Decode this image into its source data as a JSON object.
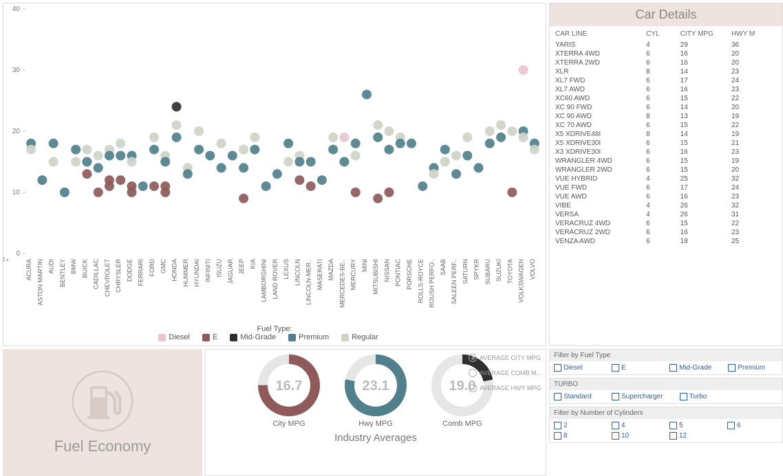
{
  "colors": {
    "diesel": "#e9c6cf",
    "e": "#8e5a5a",
    "mid": "#2f2f2f",
    "premium": "#4f808b",
    "regular": "#cdd5c7"
  },
  "chart_data": {
    "type": "scatter",
    "title": "",
    "xlabel": "",
    "ylabel": "",
    "ylim": [
      0,
      40
    ],
    "yticks": [
      0,
      10,
      20,
      30,
      40
    ],
    "x_categories": [
      "ACURA",
      "ASTON MARTIN",
      "AUDI",
      "BENTLEY",
      "BMW",
      "BUICK",
      "CADILLAC",
      "CHEVROLET",
      "CHRYSLER",
      "DODGE",
      "FERRARI",
      "FORD",
      "GMC",
      "HONDA",
      "HUMMER",
      "HYUNDAI",
      "INFINITI",
      "ISUZU",
      "JAGUAR",
      "JEEP",
      "KIA",
      "LAMBORGHINI",
      "LAND ROVER",
      "LEXUS",
      "LINCOLN",
      "LINCOLN-MER..",
      "MASERATI",
      "MAZDA",
      "MERCEDES-BE..",
      "MERCURY",
      "MINI",
      "MITSUBISHI",
      "NISSAN",
      "PONTIAC",
      "PORSCHE",
      "ROLLS-ROYCE",
      "ROUSH PERFO..",
      "SAAB",
      "SALEEN PERF..",
      "SATURN",
      "SPYKR",
      "SUBARU",
      "SUZUKI",
      "TOYOTA",
      "VOLKSWAGEN",
      "VOLVO"
    ],
    "points": [
      {
        "x": "ACURA",
        "y": 18,
        "fuel": "premium"
      },
      {
        "x": "ACURA",
        "y": 17,
        "fuel": "regular"
      },
      {
        "x": "ASTON MARTIN",
        "y": 12,
        "fuel": "premium"
      },
      {
        "x": "AUDI",
        "y": 18,
        "fuel": "premium"
      },
      {
        "x": "AUDI",
        "y": 15,
        "fuel": "regular"
      },
      {
        "x": "BENTLEY",
        "y": 10,
        "fuel": "premium"
      },
      {
        "x": "BMW",
        "y": 17,
        "fuel": "premium"
      },
      {
        "x": "BMW",
        "y": 15,
        "fuel": "regular"
      },
      {
        "x": "BUICK",
        "y": 15,
        "fuel": "premium"
      },
      {
        "x": "BUICK",
        "y": 17,
        "fuel": "regular"
      },
      {
        "x": "BUICK",
        "y": 13,
        "fuel": "e"
      },
      {
        "x": "CADILLAC",
        "y": 16,
        "fuel": "regular"
      },
      {
        "x": "CADILLAC",
        "y": 14,
        "fuel": "premium"
      },
      {
        "x": "CADILLAC",
        "y": 10,
        "fuel": "e"
      },
      {
        "x": "CHEVROLET",
        "y": 17,
        "fuel": "regular"
      },
      {
        "x": "CHEVROLET",
        "y": 16,
        "fuel": "premium"
      },
      {
        "x": "CHEVROLET",
        "y": 12,
        "fuel": "e"
      },
      {
        "x": "CHEVROLET",
        "y": 11,
        "fuel": "e"
      },
      {
        "x": "CHRYSLER",
        "y": 18,
        "fuel": "regular"
      },
      {
        "x": "CHRYSLER",
        "y": 16,
        "fuel": "premium"
      },
      {
        "x": "CHRYSLER",
        "y": 12,
        "fuel": "e"
      },
      {
        "x": "DODGE",
        "y": 16,
        "fuel": "premium"
      },
      {
        "x": "DODGE",
        "y": 15,
        "fuel": "regular"
      },
      {
        "x": "DODGE",
        "y": 11,
        "fuel": "e"
      },
      {
        "x": "DODGE",
        "y": 10,
        "fuel": "e"
      },
      {
        "x": "FERRARI",
        "y": 11,
        "fuel": "premium"
      },
      {
        "x": "FORD",
        "y": 19,
        "fuel": "regular"
      },
      {
        "x": "FORD",
        "y": 17,
        "fuel": "premium"
      },
      {
        "x": "FORD",
        "y": 11,
        "fuel": "e"
      },
      {
        "x": "GMC",
        "y": 16,
        "fuel": "regular"
      },
      {
        "x": "GMC",
        "y": 15,
        "fuel": "premium"
      },
      {
        "x": "GMC",
        "y": 11,
        "fuel": "e"
      },
      {
        "x": "GMC",
        "y": 10,
        "fuel": "e"
      },
      {
        "x": "HONDA",
        "y": 24,
        "fuel": "mid"
      },
      {
        "x": "HONDA",
        "y": 21,
        "fuel": "regular"
      },
      {
        "x": "HONDA",
        "y": 19,
        "fuel": "premium"
      },
      {
        "x": "HUMMER",
        "y": 14,
        "fuel": "regular"
      },
      {
        "x": "HUMMER",
        "y": 13,
        "fuel": "premium"
      },
      {
        "x": "HYUNDAI",
        "y": 20,
        "fuel": "regular"
      },
      {
        "x": "HYUNDAI",
        "y": 17,
        "fuel": "premium"
      },
      {
        "x": "INFINITI",
        "y": 16,
        "fuel": "premium"
      },
      {
        "x": "ISUZU",
        "y": 18,
        "fuel": "regular"
      },
      {
        "x": "ISUZU",
        "y": 14,
        "fuel": "premium"
      },
      {
        "x": "JAGUAR",
        "y": 16,
        "fuel": "premium"
      },
      {
        "x": "JEEP",
        "y": 17,
        "fuel": "regular"
      },
      {
        "x": "JEEP",
        "y": 14,
        "fuel": "premium"
      },
      {
        "x": "JEEP",
        "y": 9,
        "fuel": "e"
      },
      {
        "x": "KIA",
        "y": 19,
        "fuel": "regular"
      },
      {
        "x": "KIA",
        "y": 17,
        "fuel": "premium"
      },
      {
        "x": "LAMBORGHINI",
        "y": 11,
        "fuel": "premium"
      },
      {
        "x": "LAND ROVER",
        "y": 13,
        "fuel": "premium"
      },
      {
        "x": "LEXUS",
        "y": 18,
        "fuel": "premium"
      },
      {
        "x": "LEXUS",
        "y": 15,
        "fuel": "regular"
      },
      {
        "x": "LINCOLN",
        "y": 16,
        "fuel": "regular"
      },
      {
        "x": "LINCOLN",
        "y": 15,
        "fuel": "premium"
      },
      {
        "x": "LINCOLN",
        "y": 12,
        "fuel": "e"
      },
      {
        "x": "LINCOLN-MER..",
        "y": 15,
        "fuel": "premium"
      },
      {
        "x": "LINCOLN-MER..",
        "y": 11,
        "fuel": "e"
      },
      {
        "x": "MASERATI",
        "y": 12,
        "fuel": "premium"
      },
      {
        "x": "MAZDA",
        "y": 19,
        "fuel": "regular"
      },
      {
        "x": "MAZDA",
        "y": 17,
        "fuel": "premium"
      },
      {
        "x": "MERCEDES-BE..",
        "y": 19,
        "fuel": "diesel"
      },
      {
        "x": "MERCEDES-BE..",
        "y": 15,
        "fuel": "premium"
      },
      {
        "x": "MERCURY",
        "y": 18,
        "fuel": "premium"
      },
      {
        "x": "MERCURY",
        "y": 16,
        "fuel": "regular"
      },
      {
        "x": "MERCURY",
        "y": 10,
        "fuel": "e"
      },
      {
        "x": "MINI",
        "y": 26,
        "fuel": "premium"
      },
      {
        "x": "MITSUBISHI",
        "y": 21,
        "fuel": "regular"
      },
      {
        "x": "MITSUBISHI",
        "y": 19,
        "fuel": "premium"
      },
      {
        "x": "MITSUBISHI",
        "y": 9,
        "fuel": "e"
      },
      {
        "x": "NISSAN",
        "y": 20,
        "fuel": "regular"
      },
      {
        "x": "NISSAN",
        "y": 17,
        "fuel": "premium"
      },
      {
        "x": "NISSAN",
        "y": 10,
        "fuel": "e"
      },
      {
        "x": "PONTIAC",
        "y": 19,
        "fuel": "regular"
      },
      {
        "x": "PONTIAC",
        "y": 18,
        "fuel": "premium"
      },
      {
        "x": "PORSCHE",
        "y": 18,
        "fuel": "premium"
      },
      {
        "x": "ROLLS-ROYCE",
        "y": 11,
        "fuel": "premium"
      },
      {
        "x": "ROUSH PERFO..",
        "y": 14,
        "fuel": "premium"
      },
      {
        "x": "ROUSH PERFO..",
        "y": 13,
        "fuel": "regular"
      },
      {
        "x": "SAAB",
        "y": 17,
        "fuel": "premium"
      },
      {
        "x": "SAAB",
        "y": 15,
        "fuel": "regular"
      },
      {
        "x": "SALEEN PERF..",
        "y": 16,
        "fuel": "regular"
      },
      {
        "x": "SALEEN PERF..",
        "y": 13,
        "fuel": "premium"
      },
      {
        "x": "SATURN",
        "y": 19,
        "fuel": "regular"
      },
      {
        "x": "SATURN",
        "y": 16,
        "fuel": "premium"
      },
      {
        "x": "SPYKR",
        "y": 14,
        "fuel": "premium"
      },
      {
        "x": "SUBARU",
        "y": 20,
        "fuel": "regular"
      },
      {
        "x": "SUBARU",
        "y": 18,
        "fuel": "premium"
      },
      {
        "x": "SUZUKI",
        "y": 21,
        "fuel": "regular"
      },
      {
        "x": "SUZUKI",
        "y": 19,
        "fuel": "premium"
      },
      {
        "x": "TOYOTA",
        "y": 20,
        "fuel": "regular"
      },
      {
        "x": "TOYOTA",
        "y": 10,
        "fuel": "e"
      },
      {
        "x": "VOLKSWAGEN",
        "y": 30,
        "fuel": "diesel"
      },
      {
        "x": "VOLKSWAGEN",
        "y": 20,
        "fuel": "premium"
      },
      {
        "x": "VOLKSWAGEN",
        "y": 19,
        "fuel": "regular"
      },
      {
        "x": "VOLVO",
        "y": 18,
        "fuel": "premium"
      },
      {
        "x": "VOLVO",
        "y": 17,
        "fuel": "regular"
      }
    ],
    "legend": {
      "title": "Fuel Type:",
      "items": [
        {
          "k": "diesel",
          "label": "Diesel"
        },
        {
          "k": "e",
          "label": "E"
        },
        {
          "k": "mid",
          "label": "Mid-Grade"
        },
        {
          "k": "premium",
          "label": "Premium"
        },
        {
          "k": "regular",
          "label": "Regular"
        }
      ]
    }
  },
  "table": {
    "title": "Car Details",
    "headers": [
      "CAR LINE",
      "CYL",
      "CITY MPG",
      "HWY M"
    ],
    "rows": [
      [
        "YARIS",
        "4",
        "29",
        "36"
      ],
      [
        "XTERRA 4WD",
        "6",
        "16",
        "20"
      ],
      [
        "XTERRA 2WD",
        "6",
        "16",
        "20"
      ],
      [
        "XLR",
        "8",
        "14",
        "23"
      ],
      [
        "XL7 FWD",
        "6",
        "17",
        "24"
      ],
      [
        "XL7 AWD",
        "6",
        "16",
        "23"
      ],
      [
        "XC60 AWD",
        "6",
        "15",
        "22"
      ],
      [
        "XC 90 FWD",
        "6",
        "14",
        "20"
      ],
      [
        "XC 90 AWD",
        "8",
        "13",
        "19"
      ],
      [
        "XC 70 AWD",
        "6",
        "15",
        "22"
      ],
      [
        "X5 XDRIVE48I",
        "8",
        "14",
        "19"
      ],
      [
        "X5 XDRIVE30I",
        "6",
        "15",
        "21"
      ],
      [
        "X3 XDRIVE30I",
        "6",
        "16",
        "23"
      ],
      [
        "WRANGLER 4WD",
        "6",
        "15",
        "19"
      ],
      [
        "WRANGLER 2WD",
        "6",
        "15",
        "20"
      ],
      [
        "VUE HYBRID",
        "4",
        "25",
        "32"
      ],
      [
        "VUE FWD",
        "6",
        "17",
        "24"
      ],
      [
        "VUE AWD",
        "6",
        "16",
        "23"
      ],
      [
        "VIBE",
        "4",
        "26",
        "32"
      ],
      [
        "VERSA",
        "4",
        "26",
        "31"
      ],
      [
        "VERACRUZ 4WD",
        "6",
        "15",
        "22"
      ],
      [
        "VERACRUZ 2WD",
        "6",
        "16",
        "23"
      ],
      [
        "VENZA AWD",
        "6",
        "18",
        "25"
      ]
    ]
  },
  "fuel_card": {
    "title": "Fuel Economy"
  },
  "gauges": {
    "title": "Industry Averages",
    "items": [
      {
        "label": "City MPG",
        "value": "16.7",
        "color": "#8e5a5a",
        "frac": 0.75
      },
      {
        "label": "Hwy MPG",
        "value": "23.1",
        "color": "#4f808b",
        "frac": 0.78
      },
      {
        "label": "Comb MPG",
        "value": "19.0",
        "color": "#2f2f2f",
        "frac": 0.22
      }
    ],
    "radios": [
      {
        "label": "AVERAGE CITY MPG",
        "selected": true
      },
      {
        "label": "AVERAGE COMB M...",
        "selected": false
      },
      {
        "label": "AVERAGE HWY MPG",
        "selected": false
      }
    ]
  },
  "filters": {
    "fuel": {
      "title": "Filter by Fuel Type",
      "items": [
        "Diesel",
        "E",
        "Mid-Grade",
        "Premium"
      ]
    },
    "turbo": {
      "title": "TURBO",
      "items": [
        "Standard",
        "Supercharger",
        "Turbo"
      ]
    },
    "cyl": {
      "title": "Filter by Number of Cylinders",
      "items": [
        "2",
        "4",
        "5",
        "6",
        "8",
        "10",
        "12"
      ]
    }
  },
  "reset_icon": "↕₊"
}
